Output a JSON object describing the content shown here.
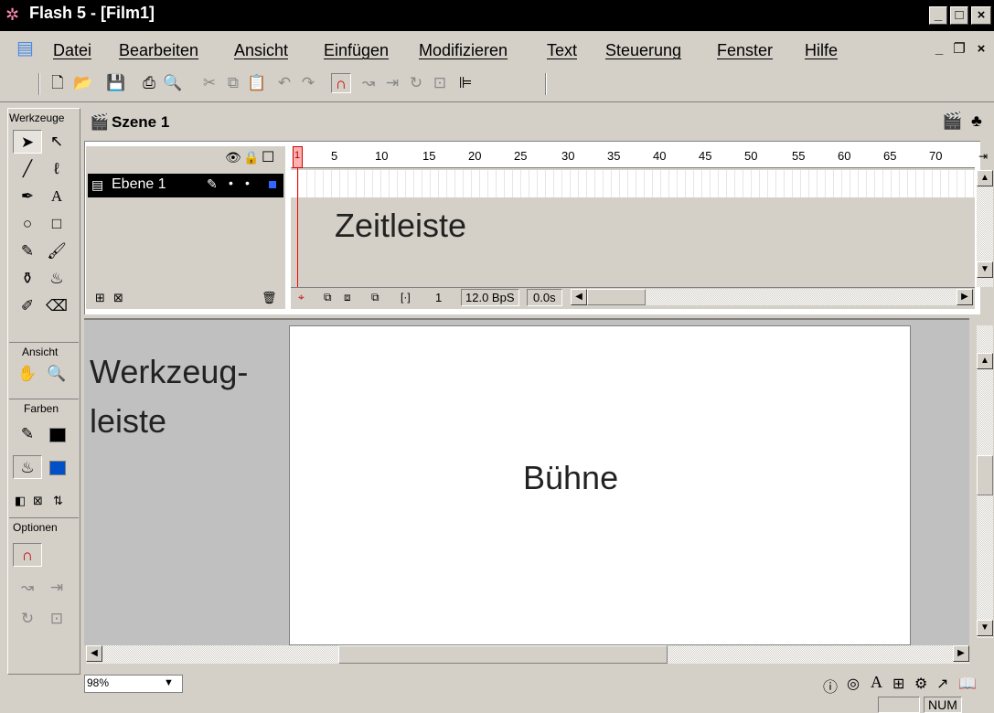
{
  "window": {
    "title": "Flash 5 - [Film1]",
    "buttons": {
      "minimize": "_",
      "maximize": "□",
      "close": "×"
    }
  },
  "menu": {
    "items": [
      "Datei",
      "Bearbeiten",
      "Ansicht",
      "Einfügen",
      "Modifizieren",
      "Text",
      "Steuerung",
      "Fenster",
      "Hilfe"
    ],
    "mdi_buttons": {
      "minimize": "_",
      "restore": "❐",
      "close": "×"
    }
  },
  "toolbar": {
    "icons": [
      "new-icon",
      "open-icon",
      "save-icon",
      "print-icon",
      "print-preview-icon",
      "cut-icon",
      "copy-icon",
      "paste-icon",
      "undo-icon",
      "redo-icon",
      "snap-magnet-icon",
      "smooth-icon",
      "straighten-icon",
      "rotate-icon",
      "scale-icon",
      "align-icon"
    ]
  },
  "tools_panel": {
    "header": "Werkzeuge",
    "tools": [
      "arrow-tool-icon",
      "subselect-tool-icon",
      "line-tool-icon",
      "lasso-tool-icon",
      "pen-tool-icon",
      "text-tool-icon",
      "oval-tool-icon",
      "rectangle-tool-icon",
      "pencil-tool-icon",
      "brush-tool-icon",
      "ink-bottle-tool-icon",
      "paint-bucket-tool-icon",
      "dropper-tool-icon",
      "eraser-tool-icon"
    ],
    "view_label": "Ansicht",
    "view_tools": [
      "hand-tool-icon",
      "zoom-tool-icon"
    ],
    "colors_label": "Farben",
    "stroke_color": "#000000",
    "fill_color": "#0050c8",
    "options_label": "Optionen"
  },
  "scene": {
    "title": "Szene 1"
  },
  "timeline": {
    "layer_name": "Ebene 1",
    "ruler_numbers": [
      "5",
      "10",
      "15",
      "20",
      "25",
      "30",
      "35",
      "40",
      "45",
      "50",
      "55",
      "60",
      "65",
      "70"
    ],
    "current_frame": "1",
    "frame_rate": "12.0 BpS",
    "elapsed": "0.0s",
    "playhead_marker": "1"
  },
  "annotations": {
    "timeline": "Zeitleiste",
    "toolbar_line1": "Werkzeug-",
    "toolbar_line2": "leiste",
    "stage": "Bühne"
  },
  "status": {
    "zoom": "98%",
    "num_indicator": "NUM"
  },
  "colors": {
    "titlebar_bg": "#000000",
    "panel_bg": "#d4d0c8",
    "stage_bg": "#ffffff",
    "playhead": "#ff0000",
    "layer_color_swatch": "#3366ff"
  }
}
